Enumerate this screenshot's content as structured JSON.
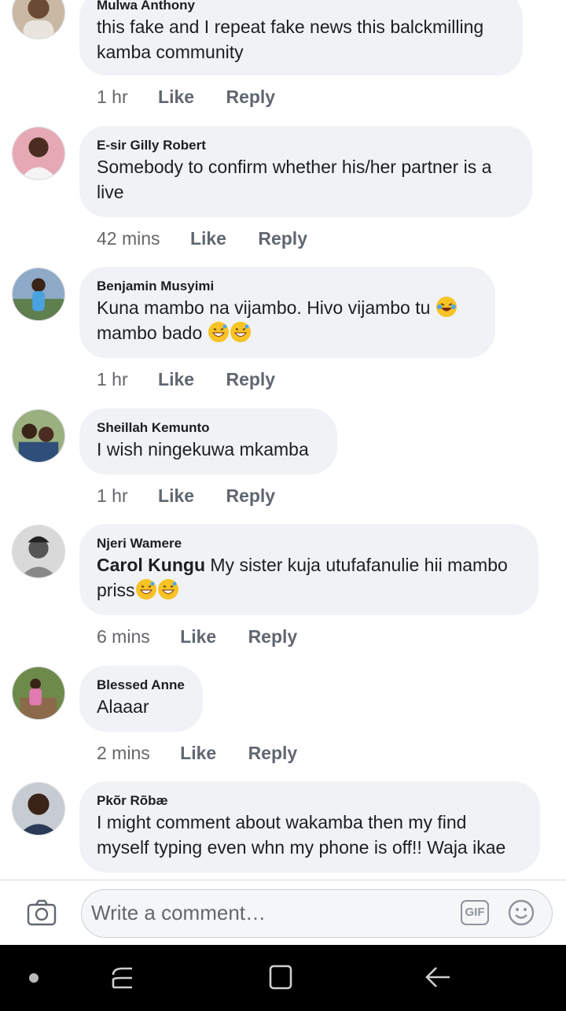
{
  "comments": [
    {
      "author": "Mulwa Anthony",
      "mention": "",
      "lines": [
        "this fake and I repeat fake news this balckmilling",
        "kamba community"
      ],
      "time": "1 hr",
      "like": "Like",
      "reply": "Reply"
    },
    {
      "author": "E-sir Gilly Robert",
      "mention": "",
      "lines": [
        "Somebody to confirm whether his/her partner is a",
        "live"
      ],
      "time": "42 mins",
      "like": "Like",
      "reply": "Reply"
    },
    {
      "author": "Benjamin Musyimi",
      "mention": "",
      "lines": [
        "Kuna mambo na vijambo. Hivo vijambo tu",
        "mambo bado"
      ],
      "time": "1 hr",
      "like": "Like",
      "reply": "Reply"
    },
    {
      "author": "Sheillah Kemunto",
      "mention": "",
      "lines": [
        "I wish ningekuwa mkamba"
      ],
      "time": "1 hr",
      "like": "Like",
      "reply": "Reply"
    },
    {
      "author": "Njeri Wamere",
      "mention": "Carol Kungu",
      "lines": [
        " My sister kuja utufafanulie hii mambo",
        "priss"
      ],
      "time": "6 mins",
      "like": "Like",
      "reply": "Reply"
    },
    {
      "author": "Blessed Anne",
      "mention": "",
      "lines": [
        "Alaaar"
      ],
      "time": "2 mins",
      "like": "Like",
      "reply": "Reply"
    },
    {
      "author": "Pkõr Rõbæ",
      "mention": "",
      "lines": [
        "I might comment about wakamba then my find",
        "myself typing even whn my phone is off!! Waja ikae"
      ],
      "time": "",
      "like": "",
      "reply": ""
    }
  ],
  "composer": {
    "placeholder": "Write a comment…",
    "gif_label": "GIF",
    "icons": [
      "camera-icon",
      "gif-icon",
      "smiley-icon"
    ]
  },
  "navbar": {
    "icons": [
      "dot-icon",
      "recent-apps-icon",
      "home-icon",
      "back-icon"
    ]
  }
}
